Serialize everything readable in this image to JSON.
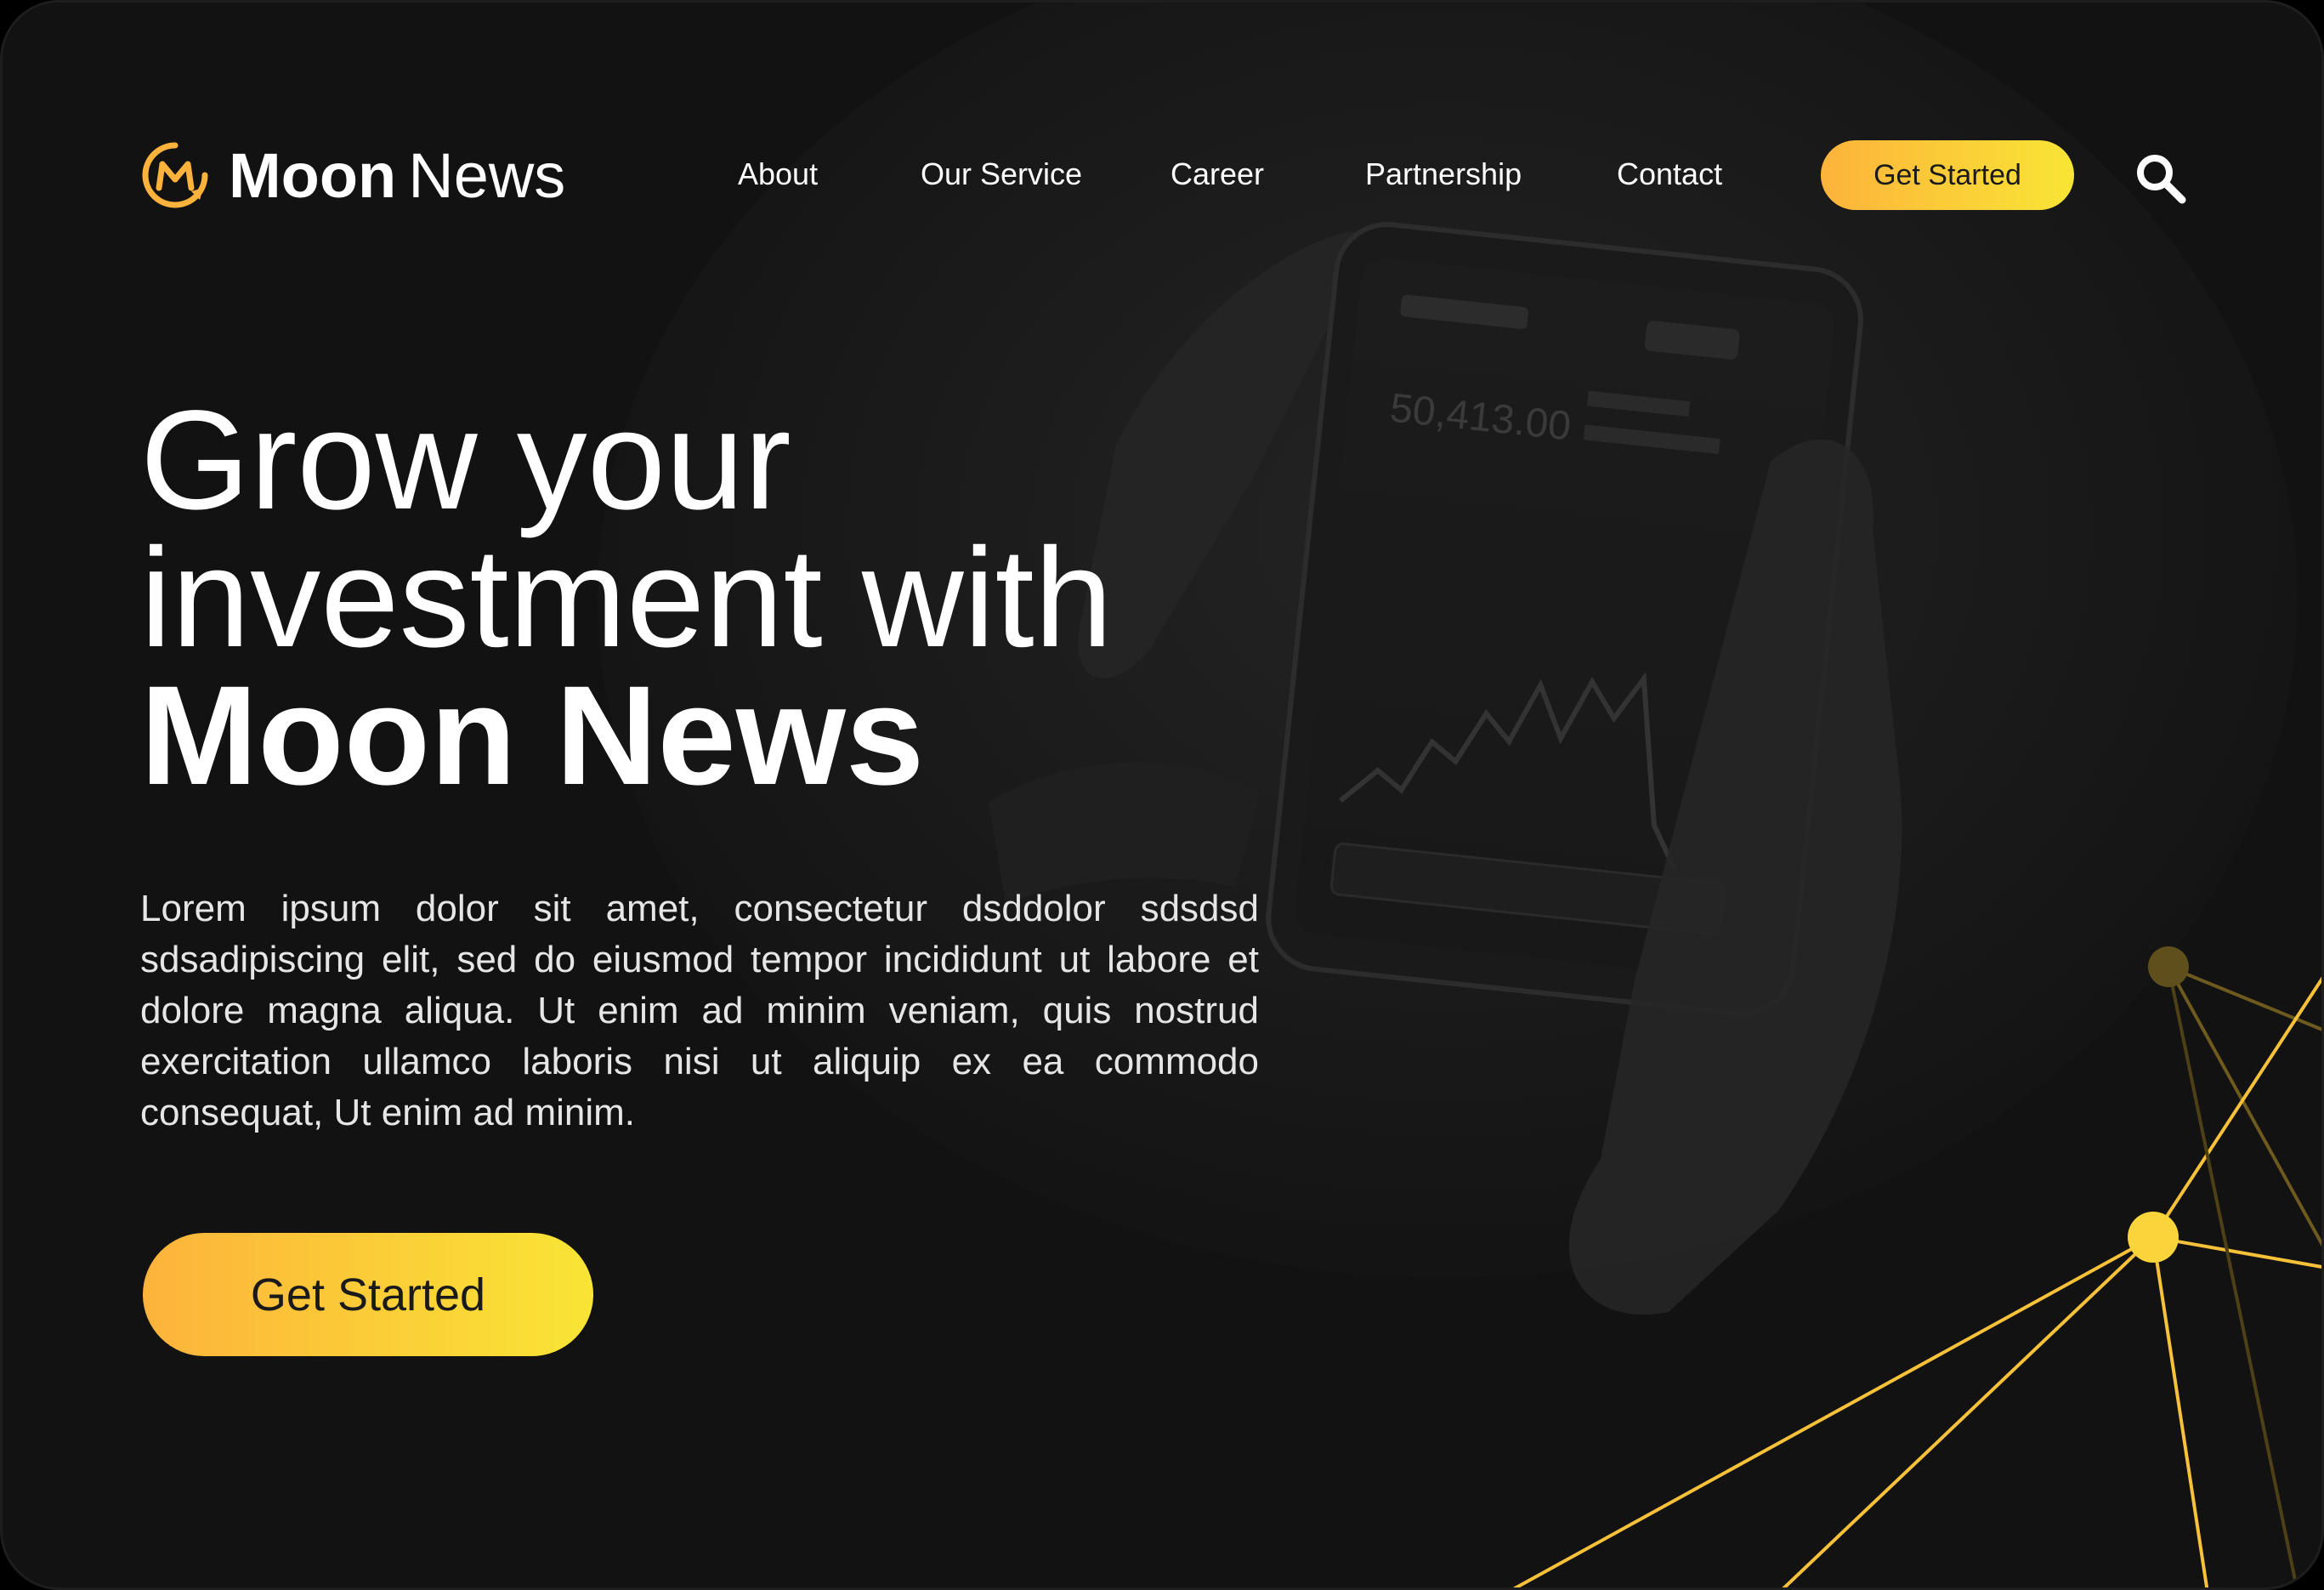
{
  "brand": {
    "name_bold": "Moon",
    "name_regular": "News",
    "logo_icon": "moon-news-logo-icon",
    "accent_color": "#fdb33b",
    "accent_color_end": "#f9e535"
  },
  "nav": {
    "items": [
      {
        "label": "About"
      },
      {
        "label": "Our Service"
      },
      {
        "label": "Career"
      },
      {
        "label": "Partnership"
      },
      {
        "label": "Contact"
      }
    ],
    "cta_label": "Get Started",
    "search_icon": "search-icon"
  },
  "hero": {
    "headline_line1": "Grow your",
    "headline_line2": "investment with",
    "headline_line3": "Moon News",
    "body": "Lorem ipsum dolor sit amet, consectetur dsddolor sdsdsd sdsadipiscing elit, sed do eiusmod tempor incididunt ut labore et dolore magna aliqua. Ut enim ad minim veniam, quis nostrud exercitation ullamco laboris nisi ut aliquip ex ea commodo consequat, Ut enim ad minim.",
    "cta_label": "Get Started"
  },
  "colors": {
    "background": "#121212",
    "text": "#ffffff",
    "network_line": "#f7c13a"
  }
}
